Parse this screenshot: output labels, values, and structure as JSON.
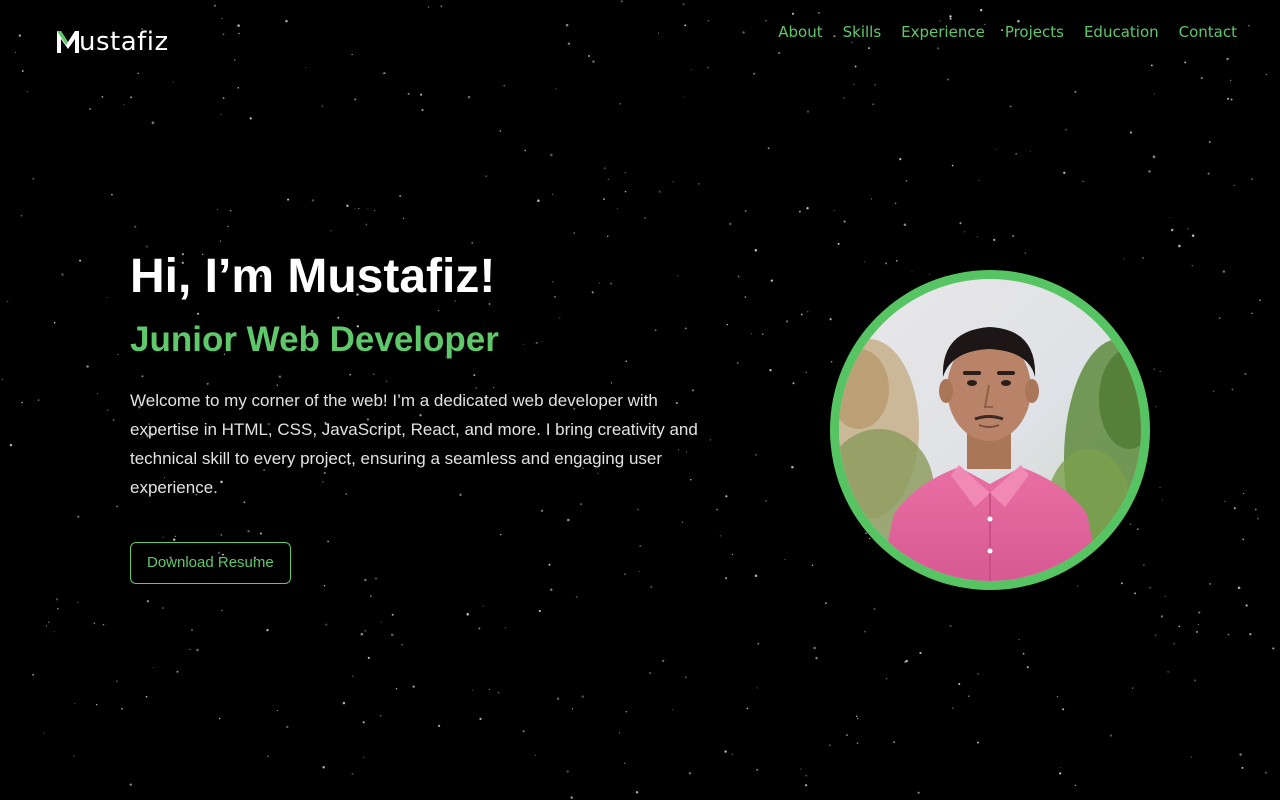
{
  "brand": {
    "logo_text": "ustafiz",
    "logo_icon": "m-logo-icon",
    "accent_color": "#5fc86a"
  },
  "nav": {
    "items": [
      {
        "label": "About"
      },
      {
        "label": "Skills"
      },
      {
        "label": "Experience"
      },
      {
        "label": "Projects"
      },
      {
        "label": "Education"
      },
      {
        "label": "Contact"
      }
    ]
  },
  "hero": {
    "greeting": "Hi, I’m Mustafiz!",
    "role": "Junior Web Developer",
    "description": "Welcome to my corner of the web! I’m a dedicated web developer with expertise in HTML, CSS, JavaScript, React, and more. I bring creativity and technical skill to every project, ensuring a seamless and engaging user experience.",
    "cta_label": "Download Resume"
  },
  "profile": {
    "ring_color": "#57c463",
    "photo_icon": "profile-photo"
  }
}
